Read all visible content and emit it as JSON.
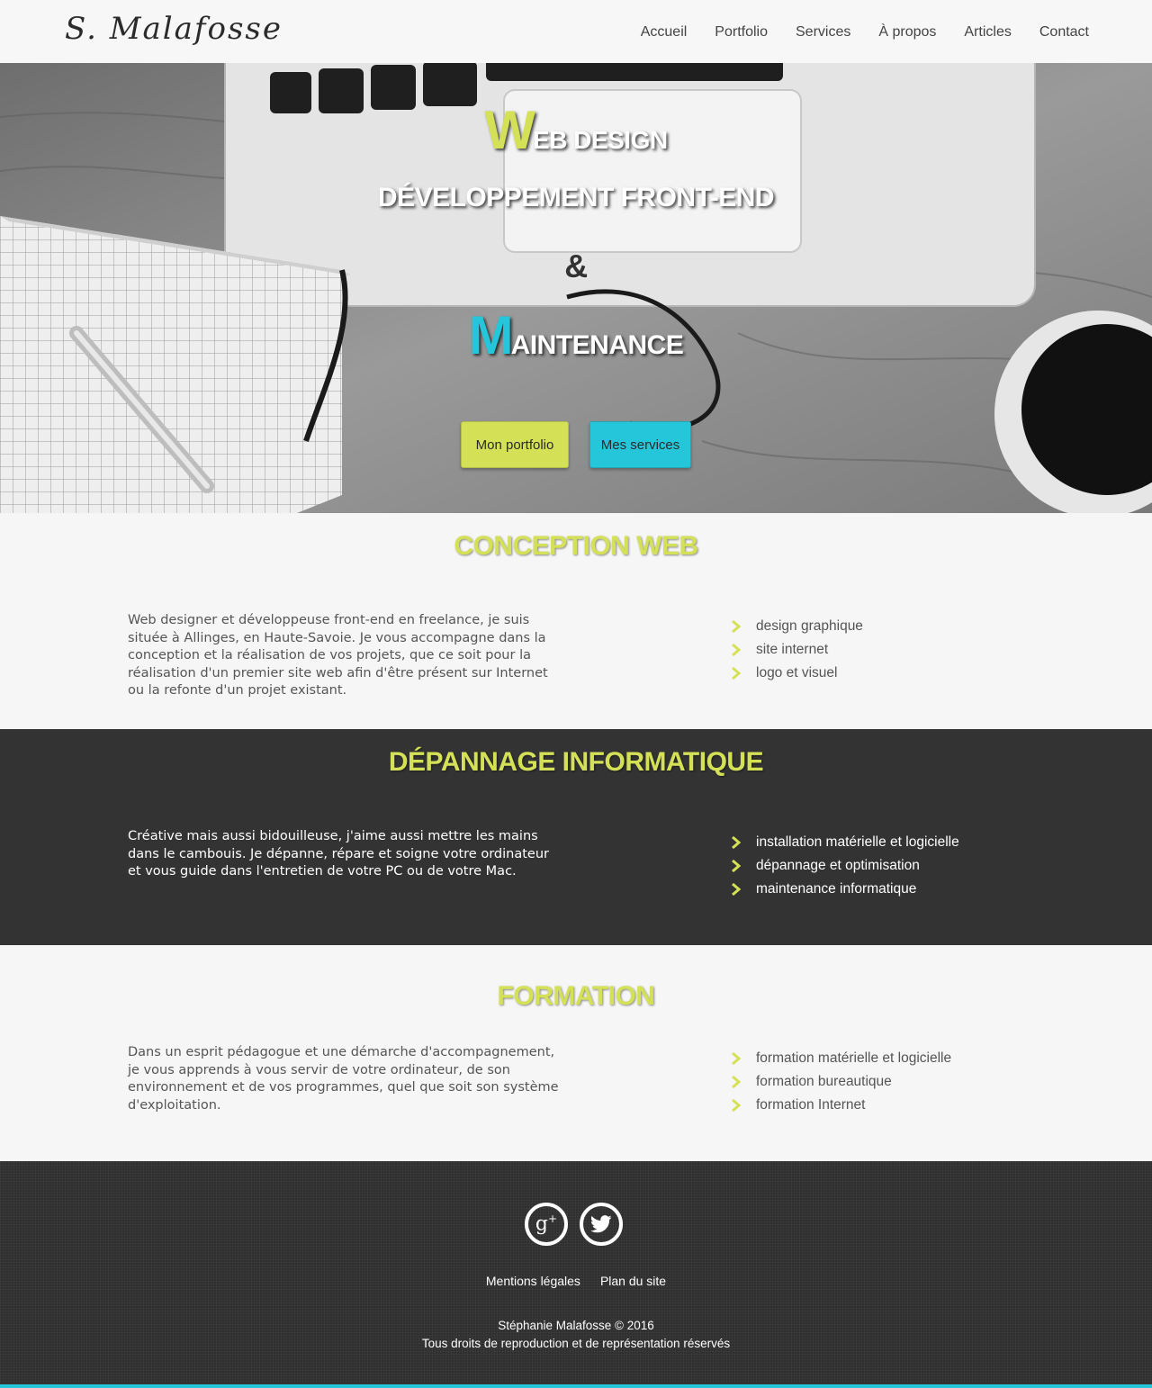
{
  "header": {
    "logo": "S. Malafosse",
    "nav": [
      "Accueil",
      "Portfolio",
      "Services",
      "À propos",
      "Articles",
      "Contact"
    ]
  },
  "hero": {
    "line1_cap": "W",
    "line1_rest": "eb design",
    "line2": "Développement front-end",
    "amp": "&",
    "line3_cap": "M",
    "line3_rest": "aintenance",
    "btn_portfolio": "Mon portfolio",
    "btn_services": "Mes services"
  },
  "sections": [
    {
      "title": "Conception web",
      "text": "Web designer et développeuse front-end en freelance, je suis située à Allinges, en Haute-Savoie. Je vous accompagne dans la conception et la réalisation de vos projets, que ce soit pour la réalisation d'un premier site web afin d'être présent sur Internet ou la refonte d'un projet existant.",
      "items": [
        "design graphique",
        "site internet",
        "logo et visuel"
      ]
    },
    {
      "title": "Dépannage informatique",
      "text": "Créative mais aussi bidouilleuse, j'aime aussi mettre les mains dans le cambouis. Je dépanne, répare et soigne votre ordinateur et vous guide dans l'entretien de votre PC ou de votre Mac.",
      "items": [
        "installation matérielle et logicielle",
        "dépannage et optimisation",
        "maintenance informatique"
      ]
    },
    {
      "title": "Formation",
      "text": "Dans un esprit pédagogue et une démarche d'accompagnement, je vous apprends à vous servir de votre ordinateur, de son environnement et de vos programmes, quel que soit son système d'exploitation.",
      "items": [
        "formation matérielle et logicielle",
        "formation bureautique",
        "formation Internet"
      ]
    }
  ],
  "footer": {
    "social": [
      "google-plus-icon",
      "twitter-icon"
    ],
    "gplus_glyph": "g",
    "gplus_plus": "+",
    "links": [
      "Mentions légales",
      "Plan du site"
    ],
    "copyright": "Stéphanie Malafosse © 2016",
    "rights": "Tous droits de reproduction et de représentation réservés"
  },
  "colors": {
    "lime": "#d4e157",
    "cyan": "#26c6da",
    "dark": "#333333",
    "light": "#f6f6f6"
  }
}
